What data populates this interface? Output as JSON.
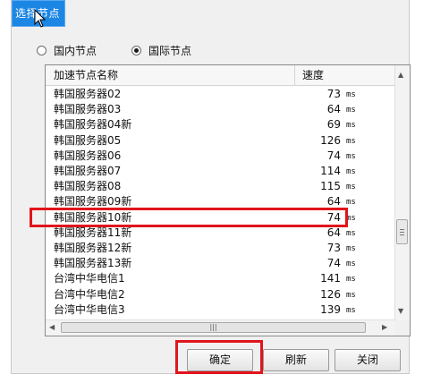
{
  "dialog": {
    "title": "选择节点"
  },
  "node_type": {
    "options": [
      {
        "label": "国内节点",
        "checked": false
      },
      {
        "label": "国际节点",
        "checked": true
      }
    ]
  },
  "server_list": {
    "columns": {
      "name": "加速节点名称",
      "speed": "速度"
    },
    "rows": [
      {
        "name": "韩国服务器02",
        "speed": "73",
        "unit": "ms"
      },
      {
        "name": "韩国服务器03",
        "speed": "64",
        "unit": "ms"
      },
      {
        "name": "韩国服务器04新",
        "speed": "69",
        "unit": "ms"
      },
      {
        "name": "韩国服务器05",
        "speed": "126",
        "unit": "ms"
      },
      {
        "name": "韩国服务器06",
        "speed": "74",
        "unit": "ms"
      },
      {
        "name": "韩国服务器07",
        "speed": "114",
        "unit": "ms"
      },
      {
        "name": "韩国服务器08",
        "speed": "115",
        "unit": "ms"
      },
      {
        "name": "韩国服务器09新",
        "speed": "64",
        "unit": "ms"
      },
      {
        "name": "韩国服务器10新",
        "speed": "74",
        "unit": "ms"
      },
      {
        "name": "韩国服务器11新",
        "speed": "64",
        "unit": "ms"
      },
      {
        "name": "韩国服务器12新",
        "speed": "73",
        "unit": "ms"
      },
      {
        "name": "韩国服务器13新",
        "speed": "74",
        "unit": "ms"
      },
      {
        "name": "台湾中华电信1",
        "speed": "141",
        "unit": "ms"
      },
      {
        "name": "台湾中华电信2",
        "speed": "126",
        "unit": "ms"
      },
      {
        "name": "台湾中华电信3",
        "speed": "139",
        "unit": "ms"
      }
    ]
  },
  "buttons": {
    "ok": "确定",
    "refresh": "刷新",
    "close": "关闭"
  },
  "colors": {
    "titlebar": "#1c86e4",
    "annotation": "#e1141b"
  }
}
